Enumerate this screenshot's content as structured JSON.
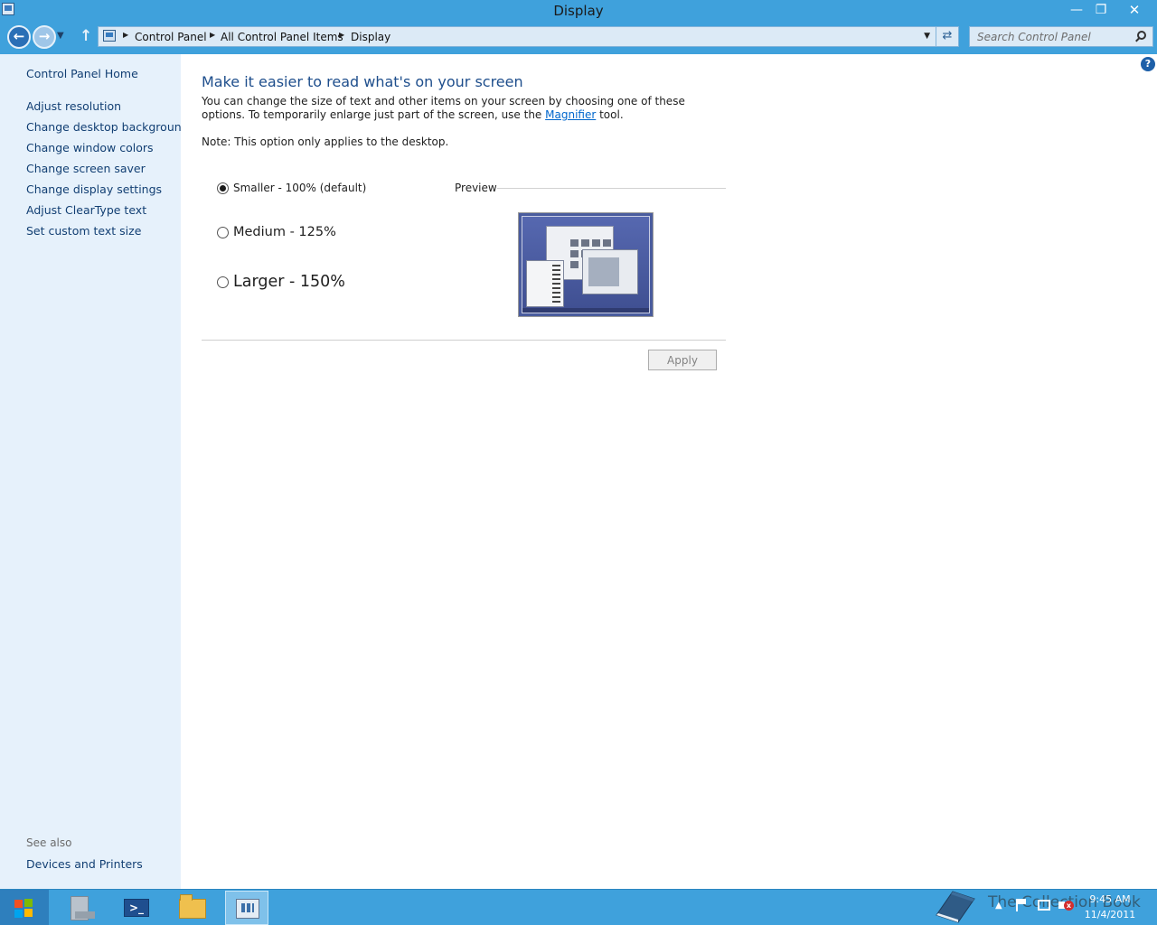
{
  "window": {
    "title": "Display"
  },
  "nav": {
    "breadcrumb": [
      "Control Panel",
      "All Control Panel Items",
      "Display"
    ],
    "search_placeholder": "Search Control Panel"
  },
  "sidebar": {
    "home": "Control Panel Home",
    "items": [
      {
        "label": "Adjust resolution"
      },
      {
        "label": "Change desktop background"
      },
      {
        "label": "Change window colors"
      },
      {
        "label": "Change screen saver"
      },
      {
        "label": "Change display settings"
      },
      {
        "label": "Adjust ClearType text"
      },
      {
        "label": "Set custom text size"
      }
    ],
    "see_also_label": "See also",
    "see_also_items": [
      {
        "label": "Devices and Printers"
      }
    ]
  },
  "main": {
    "heading": "Make it easier to read what's on your screen",
    "desc_before": "You can change the size of text and other items on your screen by choosing one of these options. To temporarily enlarge just part of the screen, use the ",
    "desc_link": "Magnifier",
    "desc_after": " tool.",
    "note": "Note: This option only applies to the desktop.",
    "options": [
      {
        "label": "Smaller - 100% (default)",
        "selected": true
      },
      {
        "label": "Medium - 125%",
        "selected": false
      },
      {
        "label": "Larger - 150%",
        "selected": false
      }
    ],
    "preview_label": "Preview",
    "apply_label": "Apply"
  },
  "taskbar": {
    "watermark": "The Collection Book",
    "time": "9:45 AM",
    "date": "11/4/2011"
  },
  "colors": {
    "accent": "#3fa1dc",
    "sidebar_bg": "#e6f1fb",
    "link": "#123f73",
    "heading": "#1e4e8c"
  },
  "icons": [
    "control-panel-icon",
    "back-arrow-icon",
    "forward-arrow-icon",
    "up-arrow-icon",
    "refresh-icon",
    "search-icon",
    "help-icon",
    "windows-logo-icon",
    "server-manager-icon",
    "powershell-icon",
    "file-explorer-icon",
    "control-panel-taskbar-icon",
    "book-icon",
    "action-center-flag-icon",
    "network-icon",
    "volume-muted-icon"
  ]
}
